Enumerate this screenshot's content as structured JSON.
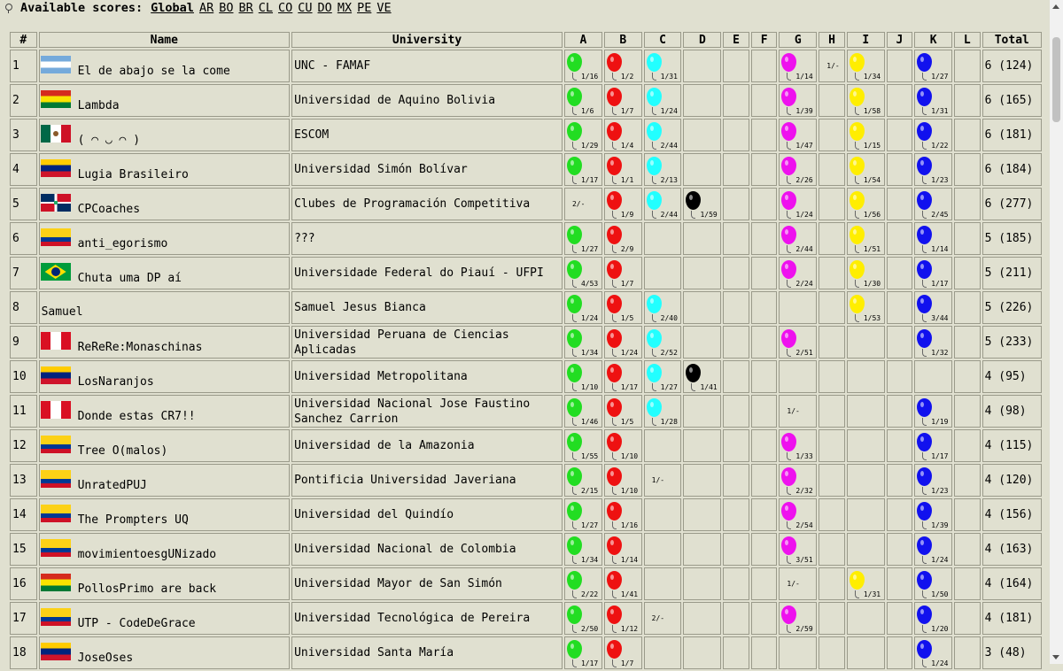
{
  "header": {
    "label": "Available scores:",
    "links": [
      "Global",
      "AR",
      "BO",
      "BR",
      "CL",
      "CO",
      "CU",
      "DO",
      "MX",
      "PE",
      "VE"
    ]
  },
  "columns": {
    "rank": "#",
    "name": "Name",
    "university": "University",
    "problems": [
      "A",
      "B",
      "C",
      "D",
      "E",
      "F",
      "G",
      "H",
      "I",
      "J",
      "K",
      "L"
    ],
    "total": "Total"
  },
  "balloon_colors": {
    "A": "#22dd22",
    "B": "#ee1111",
    "C": "#22ffff",
    "D": "#000000",
    "G": "#ee11ee",
    "I": "#ffee00",
    "K": "#1111ee"
  },
  "rows": [
    {
      "rank": "1",
      "flag": "ar",
      "name": "El de abajo se la come",
      "university": "UNC - FAMAF",
      "total": "6 (124)",
      "results": {
        "A": "1/16",
        "B": "1/2",
        "C": "1/31",
        "G": "1/14",
        "H": "1/-",
        "I": "1/34",
        "K": "1/27"
      }
    },
    {
      "rank": "2",
      "flag": "bo",
      "name": "Lambda",
      "university": "Universidad de Aquino Bolivia",
      "total": "6 (165)",
      "results": {
        "A": "1/6",
        "B": "1/7",
        "C": "1/24",
        "G": "1/39",
        "I": "1/58",
        "K": "1/31"
      }
    },
    {
      "rank": "3",
      "flag": "mx",
      "name": "( ◠ ◡ ◠ )",
      "university": "ESCOM",
      "total": "6 (181)",
      "results": {
        "A": "1/29",
        "B": "1/4",
        "C": "2/44",
        "G": "1/47",
        "I": "1/15",
        "K": "1/22"
      }
    },
    {
      "rank": "4",
      "flag": "ve",
      "name": "Lugia Brasileiro",
      "university": "Universidad Simón Bolívar",
      "total": "6 (184)",
      "results": {
        "A": "1/17",
        "B": "1/1",
        "C": "2/13",
        "G": "2/26",
        "I": "1/54",
        "K": "1/23"
      }
    },
    {
      "rank": "5",
      "flag": "do",
      "name": "CPCoaches",
      "university": "Clubes de Programación Competitiva",
      "total": "6 (277)",
      "results": {
        "A": "2/-",
        "B": "1/9",
        "C": "2/44",
        "D": "1/59",
        "G": "1/24",
        "I": "1/56",
        "K": "2/45"
      }
    },
    {
      "rank": "6",
      "flag": "co",
      "name": "anti_egorismo",
      "university": "???",
      "total": "5 (185)",
      "results": {
        "A": "1/27",
        "B": "2/9",
        "G": "2/44",
        "I": "1/51",
        "K": "1/14"
      }
    },
    {
      "rank": "7",
      "flag": "br",
      "name": "Chuta uma DP aí",
      "university": "Universidade Federal do Piauí - UFPI",
      "total": "5 (211)",
      "results": {
        "A": "4/53",
        "B": "1/7",
        "G": "2/24",
        "I": "1/30",
        "K": "1/17"
      }
    },
    {
      "rank": "8",
      "flag": "",
      "name": "Samuel",
      "university": "Samuel Jesus Bianca",
      "total": "5 (226)",
      "results": {
        "A": "1/24",
        "B": "1/5",
        "C": "2/40",
        "I": "1/53",
        "K": "3/44"
      }
    },
    {
      "rank": "9",
      "flag": "pe",
      "name": "ReReRe:Monaschinas",
      "university": "Universidad Peruana de Ciencias Aplicadas",
      "total": "5 (233)",
      "results": {
        "A": "1/34",
        "B": "1/24",
        "C": "2/52",
        "G": "2/51",
        "K": "1/32"
      }
    },
    {
      "rank": "10",
      "flag": "ve",
      "name": "LosNaranjos",
      "university": "Universidad Metropolitana",
      "total": "4 (95)",
      "results": {
        "A": "1/10",
        "B": "1/17",
        "C": "1/27",
        "D": "1/41"
      }
    },
    {
      "rank": "11",
      "flag": "pe",
      "name": "Donde estas CR7!!",
      "university": "Universidad Nacional Jose Faustino Sanchez Carrion",
      "total": "4 (98)",
      "results": {
        "A": "1/46",
        "B": "1/5",
        "C": "1/28",
        "G": "1/-",
        "K": "1/19"
      }
    },
    {
      "rank": "12",
      "flag": "co",
      "name": "Tree O(malos)",
      "university": "Universidad de la Amazonia",
      "total": "4 (115)",
      "results": {
        "A": "1/55",
        "B": "1/10",
        "G": "1/33",
        "K": "1/17"
      }
    },
    {
      "rank": "13",
      "flag": "co",
      "name": "UnratedPUJ",
      "university": "Pontificia Universidad Javeriana",
      "total": "4 (120)",
      "results": {
        "A": "2/15",
        "B": "1/10",
        "C": "1/-",
        "G": "2/32",
        "K": "1/23"
      }
    },
    {
      "rank": "14",
      "flag": "co",
      "name": "The Prompters UQ",
      "university": "Universidad del Quindío",
      "total": "4 (156)",
      "results": {
        "A": "1/27",
        "B": "1/16",
        "G": "2/54",
        "K": "1/39"
      }
    },
    {
      "rank": "15",
      "flag": "co",
      "name": "movimientoesgUNizado",
      "university": "Universidad Nacional de Colombia",
      "total": "4 (163)",
      "results": {
        "A": "1/34",
        "B": "1/14",
        "G": "3/51",
        "K": "1/24"
      }
    },
    {
      "rank": "16",
      "flag": "bo",
      "name": "PollosPrimo are back",
      "university": "Universidad Mayor de San Simón",
      "total": "4 (164)",
      "results": {
        "A": "2/22",
        "B": "1/41",
        "G": "1/-",
        "I": "1/31",
        "K": "1/50"
      }
    },
    {
      "rank": "17",
      "flag": "co",
      "name": "UTP - CodeDeGrace",
      "university": "Universidad Tecnológica de Pereira",
      "total": "4 (181)",
      "results": {
        "A": "2/50",
        "B": "1/12",
        "C": "2/-",
        "G": "2/59",
        "K": "1/20"
      }
    },
    {
      "rank": "18",
      "flag": "ve",
      "name": "JoseOses",
      "university": "Universidad Santa María",
      "total": "3 (48)",
      "results": {
        "A": "1/17",
        "B": "1/7",
        "K": "1/24"
      }
    }
  ]
}
